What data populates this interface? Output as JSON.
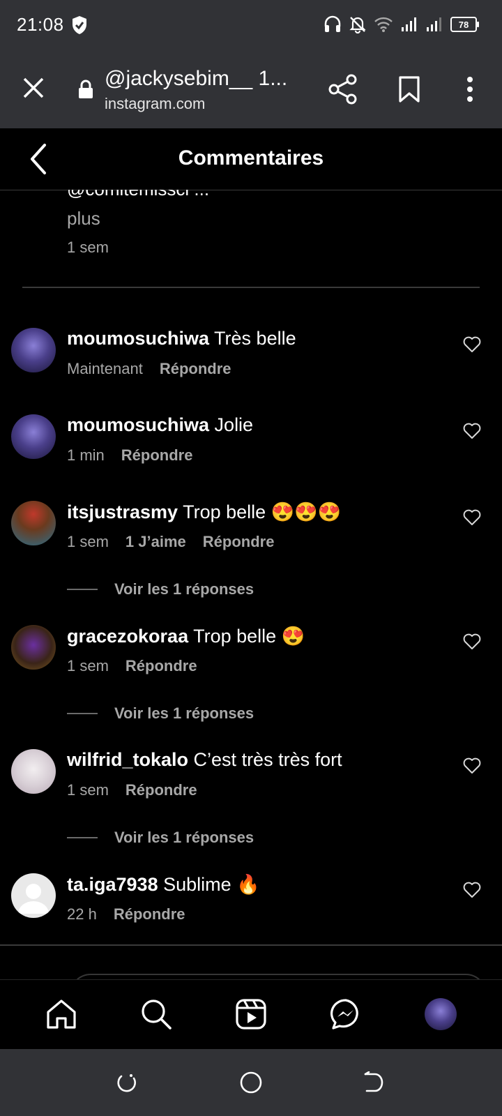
{
  "status_bar": {
    "time": "21:08",
    "battery": "78"
  },
  "browser": {
    "title": "@jackysebim__ 1...",
    "domain": "instagram.com"
  },
  "header": {
    "title": "Commentaires"
  },
  "caption": {
    "mention": "@comitemissci ...",
    "more": "plus",
    "time": "1 sem"
  },
  "comments": [
    {
      "username": "moumosuchiwa",
      "text": "Très belle",
      "time": "Maintenant",
      "likes": "",
      "reply": "Répondre",
      "view_replies": ""
    },
    {
      "username": "moumosuchiwa",
      "text": "Jolie",
      "time": "1 min",
      "likes": "",
      "reply": "Répondre",
      "view_replies": ""
    },
    {
      "username": "itsjustrasmy",
      "text": "Trop belle 😍😍😍",
      "time": "1 sem",
      "likes": "1 J’aime",
      "reply": "Répondre",
      "view_replies": "Voir les 1 réponses"
    },
    {
      "username": "gracezokoraa",
      "text": "Trop belle 😍",
      "time": "1 sem",
      "likes": "",
      "reply": "Répondre",
      "view_replies": "Voir les 1 réponses"
    },
    {
      "username": "wilfrid_tokalo",
      "text": "C’est très très fort",
      "time": "1 sem",
      "likes": "",
      "reply": "Répondre",
      "view_replies": "Voir les 1 réponses"
    },
    {
      "username": "ta.iga7938",
      "text": "Sublime 🔥",
      "time": "22 h",
      "likes": "",
      "reply": "Répondre",
      "view_replies": ""
    }
  ],
  "icons": {
    "nav": [
      "home-icon",
      "search-icon",
      "reels-icon",
      "messenger-icon",
      "profile-avatar"
    ],
    "system": [
      "recents-icon",
      "home-circle-icon",
      "back-icon"
    ]
  },
  "colors": {
    "background": "#000000",
    "chrome": "#313236",
    "secondary_text": "#a8a8a8"
  }
}
